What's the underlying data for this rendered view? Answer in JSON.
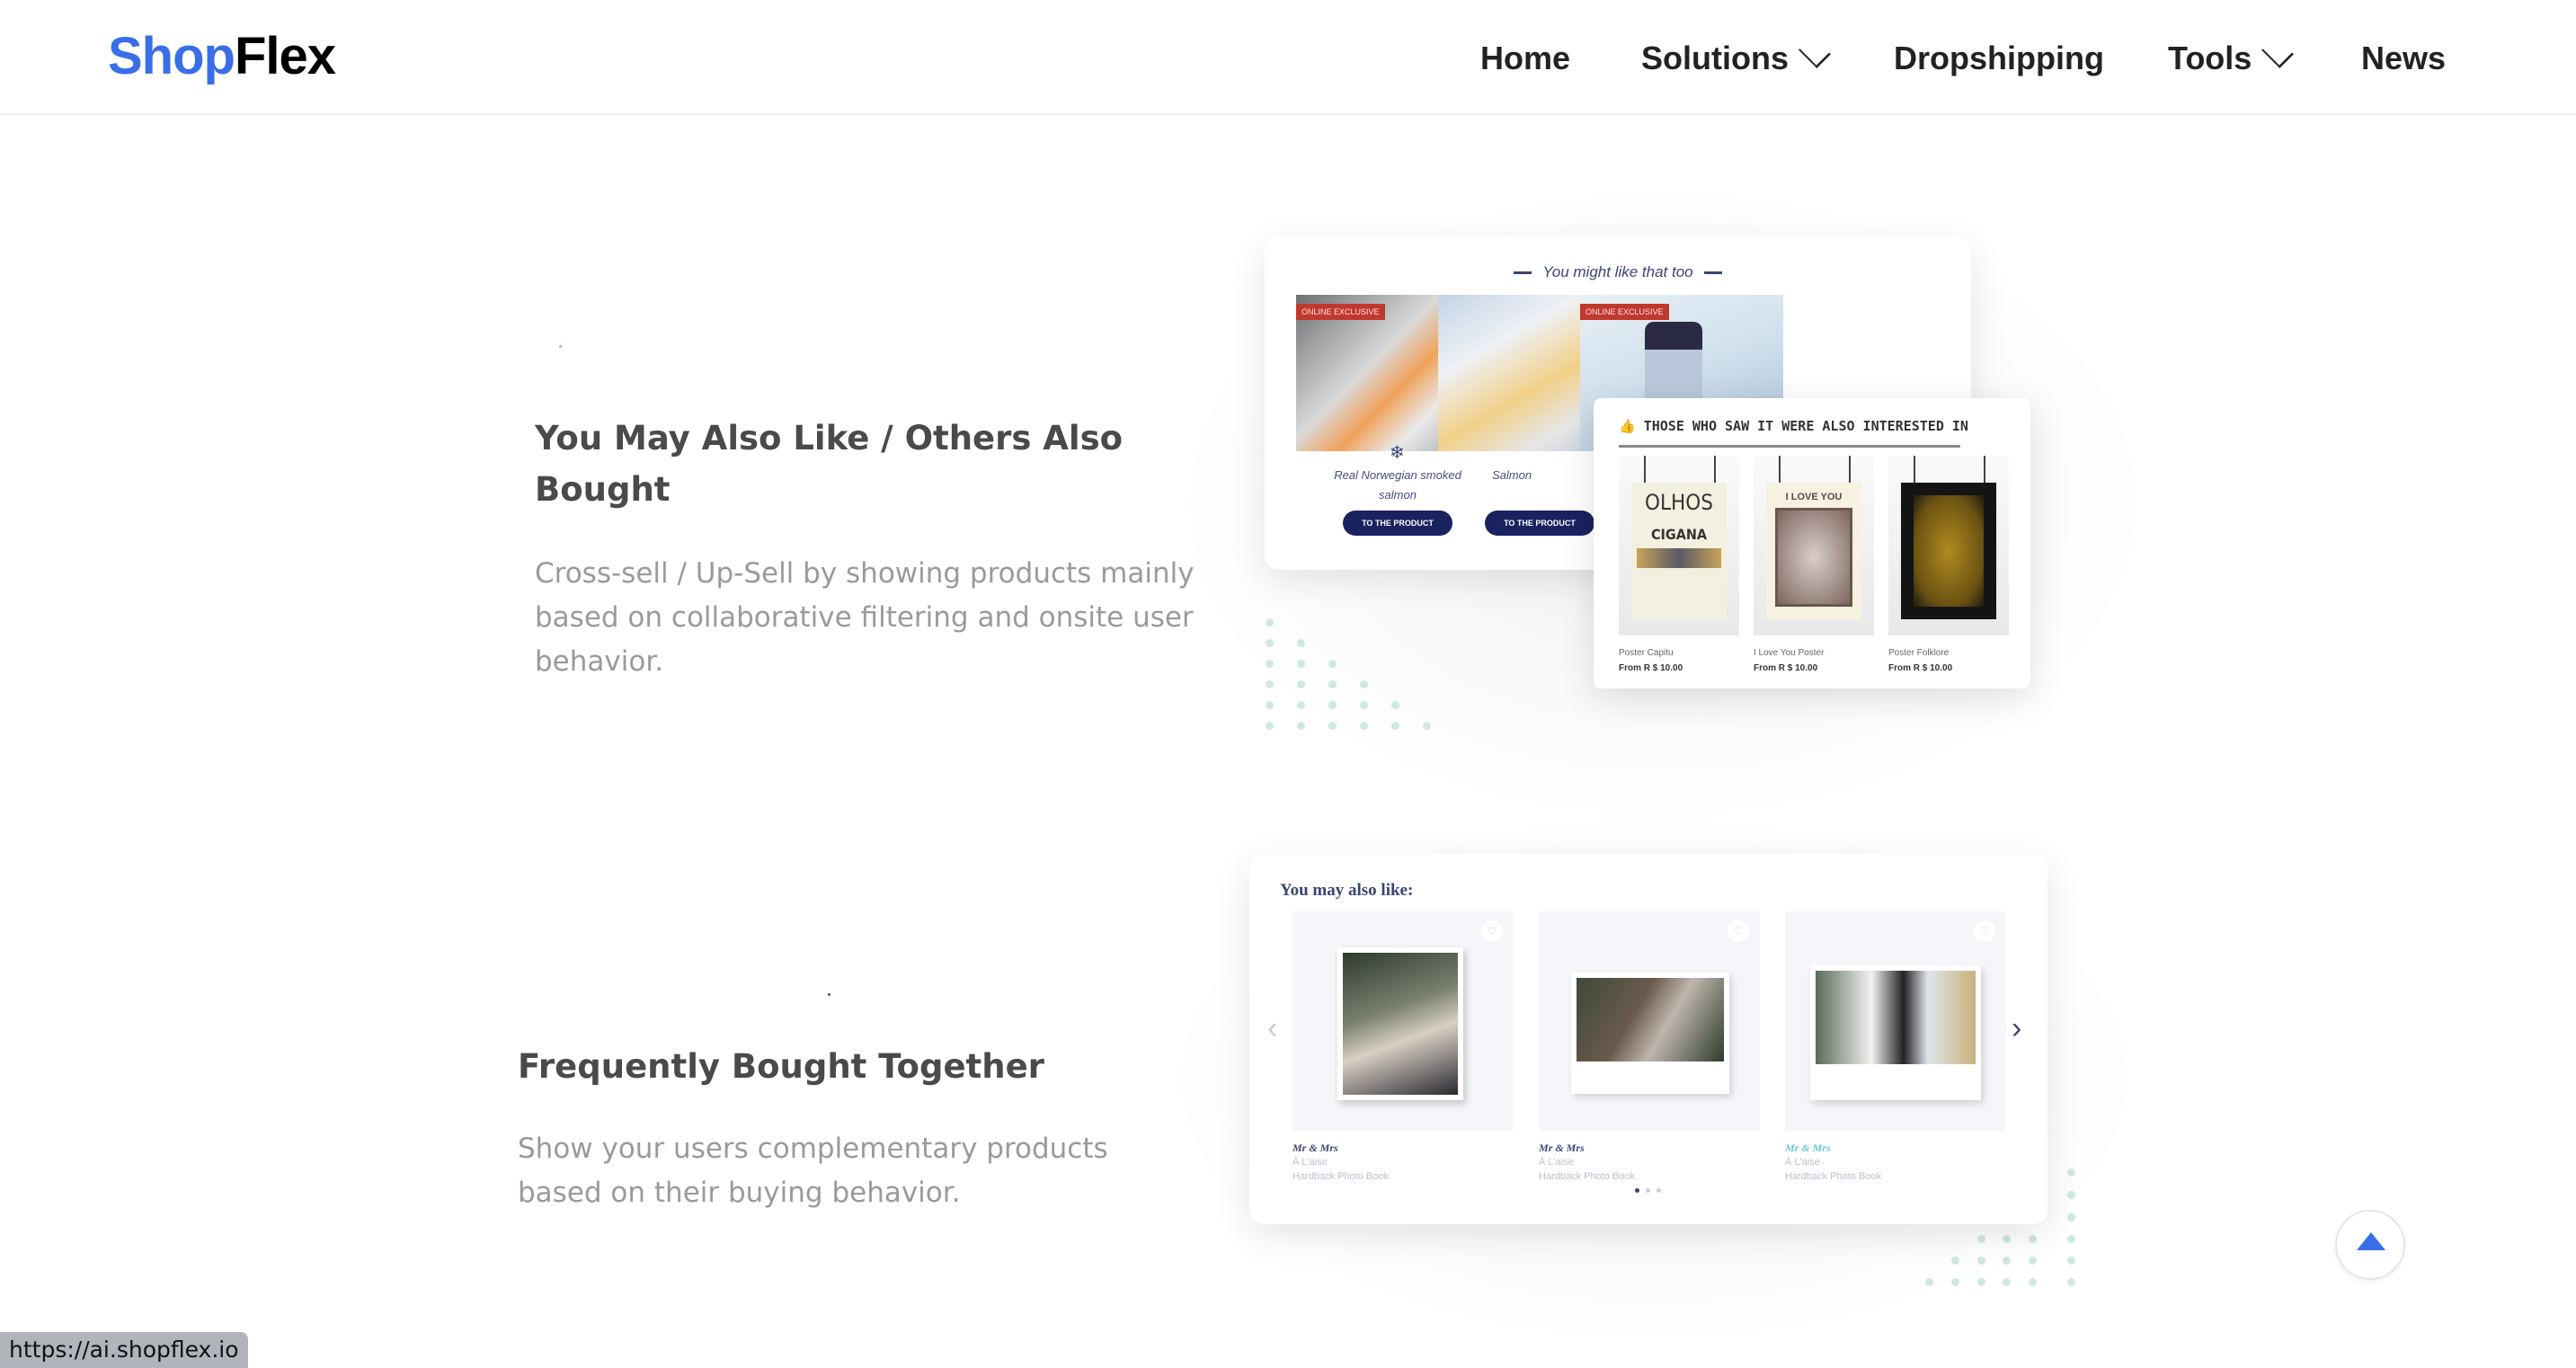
{
  "header": {
    "logo": {
      "part1": "Shop",
      "part2": "Flex"
    },
    "nav": [
      {
        "label": "Home",
        "has_dropdown": false
      },
      {
        "label": "Solutions",
        "has_dropdown": true
      },
      {
        "label": "Dropshipping",
        "has_dropdown": false
      },
      {
        "label": "Tools",
        "has_dropdown": true
      },
      {
        "label": "News",
        "has_dropdown": false
      }
    ]
  },
  "sections": [
    {
      "title": "You May Also Like / Others Also Bought",
      "title_lines": [
        "You May Also Like / Others Also",
        "Bought"
      ],
      "body_lines": [
        "Cross-sell / Up-Sell by showing products mainly",
        "based on collaborative filtering and onsite user",
        "behavior."
      ],
      "preview": {
        "widget_title": "You might like that too",
        "products": [
          {
            "name_lines": [
              "Real Norwegian smoked",
              "salmon"
            ],
            "badge": "ONLINE EXCLUSIVE",
            "button": "TO THE PRODUCT"
          },
          {
            "name_lines": [
              "Salmon"
            ],
            "badge": "",
            "button": "TO THE PRODUCT"
          },
          {
            "name_lines": [
              ""
            ],
            "badge": "ONLINE EXCLUSIVE",
            "button": ""
          }
        ],
        "overlay": {
          "title": "THOSE WHO SAW IT WERE ALSO INTERESTED IN",
          "posters": [
            {
              "name": "Poster Capitu",
              "price": "From R $ 10.00",
              "art_text": [
                "OLHOS",
                "CIGANA"
              ]
            },
            {
              "name": "I Love You Poster",
              "price": "From R $ 10.00",
              "art_text": [
                "I LOVE YOU"
              ]
            },
            {
              "name": "Poster Folklore",
              "price": "From R $ 10.00",
              "art_text": []
            }
          ]
        }
      }
    },
    {
      "title": "Frequently Bought Together",
      "body_lines": [
        "Show your users complementary products",
        "based on their buying behavior."
      ],
      "preview": {
        "widget_title": "You may also like:",
        "products": [
          {
            "name": "Mr & Mrs",
            "brand": "À L'aise",
            "type": "Hardback Photo Book",
            "name_color": "#3b4574"
          },
          {
            "name": "Mr & Mrs",
            "brand": "À L'aise",
            "type": "Hardback Photo Book",
            "name_color": "#3b4574"
          },
          {
            "name": "Mr & Mrs",
            "brand": "À L'aise",
            "type": "Hardback Photo Book",
            "name_color": "#6cc7d4"
          }
        ],
        "pager": {
          "current": 1,
          "total": 3
        }
      }
    }
  ],
  "back_to_top": {
    "icon": "triangle-up-icon"
  },
  "status_bar": {
    "url": "https://ai.shopflex.io"
  },
  "colors": {
    "brand_blue": "#3a6ee8",
    "navy": "#1a2260",
    "badge_red": "#c0392b",
    "dot_green": "#cfe9dd"
  }
}
